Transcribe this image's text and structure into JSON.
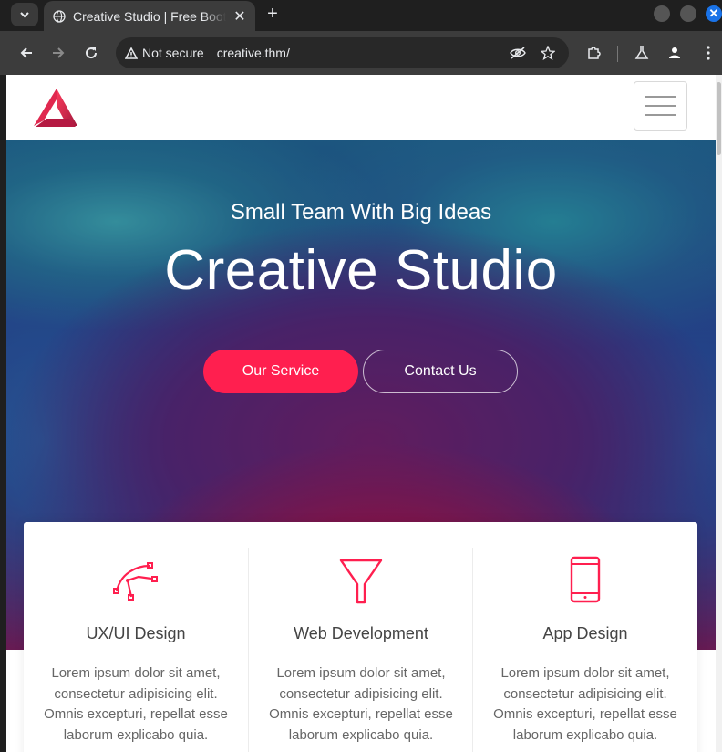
{
  "browser": {
    "tab_title": "Creative Studio | Free Bootstrap",
    "security_label": "Not secure",
    "url": "creative.thm/"
  },
  "hero": {
    "subtitle": "Small Team With Big Ideas",
    "title": "Creative Studio",
    "primary_button": "Our Service",
    "secondary_button": "Contact Us"
  },
  "services": [
    {
      "title": "UX/UI Design",
      "text": "Lorem ipsum dolor sit amet, consectetur adipisicing elit. Omnis excepturi, repellat esse laborum explicabo quia."
    },
    {
      "title": "Web Development",
      "text": "Lorem ipsum dolor sit amet, consectetur adipisicing elit. Omnis excepturi, repellat esse laborum explicabo quia."
    },
    {
      "title": "App Design",
      "text": "Lorem ipsum dolor sit amet, consectetur adipisicing elit. Omnis excepturi, repellat esse laborum explicabo quia."
    }
  ],
  "colors": {
    "accent": "#ff1f4f",
    "browser_dark": "#3c3c3c"
  }
}
